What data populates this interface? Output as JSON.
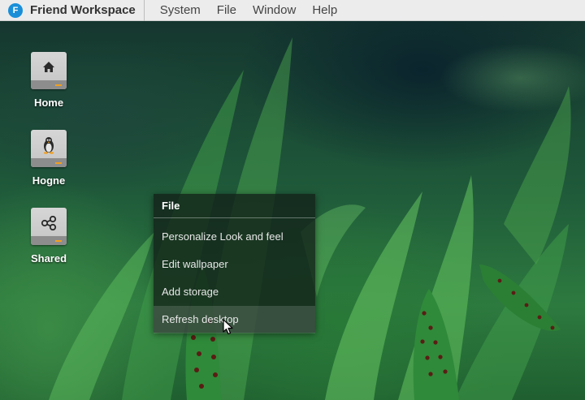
{
  "menubar": {
    "logo_letter": "F",
    "app_title": "Friend Workspace",
    "items": [
      "System",
      "File",
      "Window",
      "Help"
    ]
  },
  "desktop_icons": [
    {
      "label": "Home",
      "icon": "home-icon"
    },
    {
      "label": "Hogne",
      "icon": "tux-icon"
    },
    {
      "label": "Shared",
      "icon": "share-icon"
    }
  ],
  "context_menu": {
    "title": "File",
    "items": [
      "Personalize Look and feel",
      "Edit wallpaper",
      "Add storage",
      "Refresh desktop"
    ],
    "highlighted_item": "Refresh desktop"
  },
  "colors": {
    "menubar_bg": "#ececec",
    "logo_blue": "#1a8fd8",
    "drive_led": "#f0a020"
  }
}
